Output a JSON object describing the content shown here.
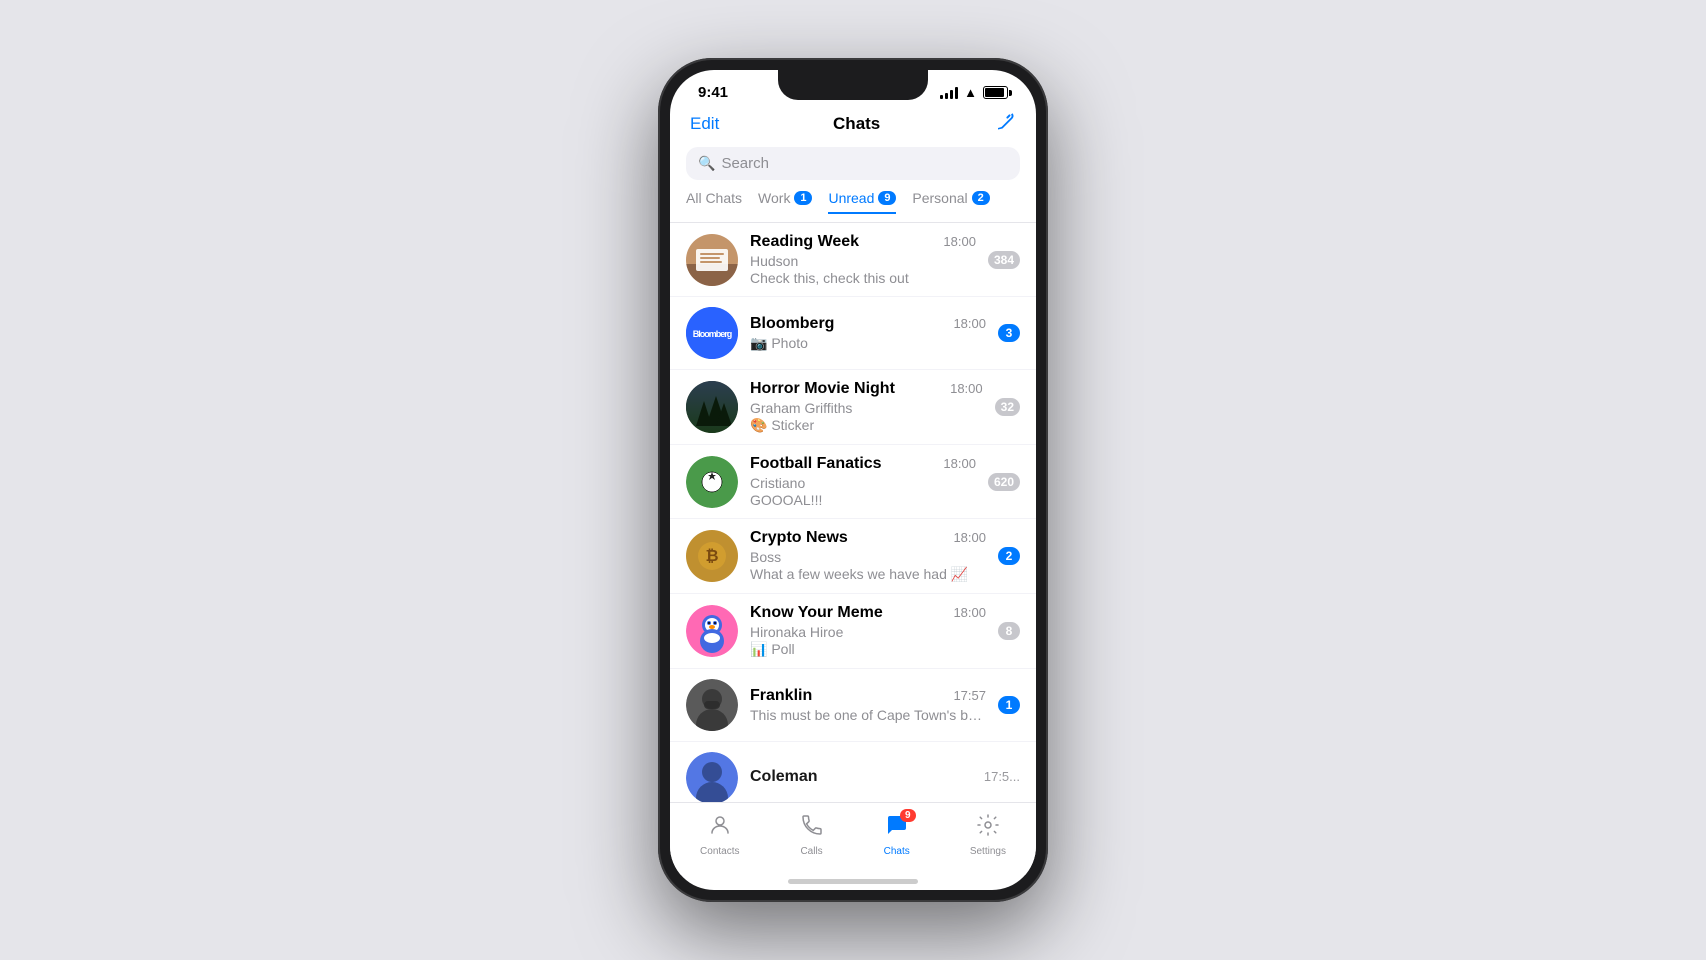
{
  "phone": {
    "status_bar": {
      "time": "9:41"
    },
    "header": {
      "edit_label": "Edit",
      "title": "Chats",
      "compose_icon": "✏"
    },
    "search": {
      "placeholder": "Search"
    },
    "tabs": [
      {
        "id": "all",
        "label": "All Chats",
        "badge": null,
        "active": false
      },
      {
        "id": "work",
        "label": "Work",
        "badge": "1",
        "active": false
      },
      {
        "id": "unread",
        "label": "Unread",
        "badge": "9",
        "active": true
      },
      {
        "id": "personal",
        "label": "Personal",
        "badge": "2",
        "active": false
      }
    ],
    "chats": [
      {
        "id": "reading-week",
        "name": "Reading Week",
        "sender": "Hudson",
        "preview": "Check this, check this out",
        "time": "18:00",
        "unread": "384",
        "unread_type": "gray",
        "avatar_type": "reading"
      },
      {
        "id": "bloomberg",
        "name": "Bloomberg",
        "sender": "",
        "preview": "📷 Photo",
        "time": "18:00",
        "unread": "3",
        "unread_type": "blue",
        "avatar_type": "bloomberg"
      },
      {
        "id": "horror-movie-night",
        "name": "Horror Movie Night",
        "sender": "Graham Griffiths",
        "preview": "🎨 Sticker",
        "time": "18:00",
        "unread": "32",
        "unread_type": "gray",
        "avatar_type": "horror"
      },
      {
        "id": "football-fanatics",
        "name": "Football Fanatics",
        "sender": "Cristiano",
        "preview": "GOOOAL!!!",
        "time": "18:00",
        "unread": "620",
        "unread_type": "gray",
        "avatar_type": "football"
      },
      {
        "id": "crypto-news",
        "name": "Crypto News",
        "sender": "Boss",
        "preview": "What a few weeks we have had 📈",
        "time": "18:00",
        "unread": "2",
        "unread_type": "blue",
        "avatar_type": "crypto"
      },
      {
        "id": "know-your-meme",
        "name": "Know Your Meme",
        "sender": "Hironaka Hiroe",
        "preview": "📊 Poll",
        "time": "18:00",
        "unread": "8",
        "unread_type": "gray",
        "avatar_type": "meme"
      },
      {
        "id": "franklin",
        "name": "Franklin",
        "sender": "",
        "preview": "This must be one of Cape Town's best spots for a stunning view of...",
        "time": "17:57",
        "unread": "1",
        "unread_type": "blue",
        "avatar_type": "franklin"
      },
      {
        "id": "coleman",
        "name": "Coleman",
        "sender": "",
        "preview": "",
        "time": "17:5...",
        "unread": null,
        "unread_type": "",
        "avatar_type": "coleman"
      }
    ],
    "bottom_nav": [
      {
        "id": "contacts",
        "icon": "contacts",
        "label": "Contacts",
        "active": false,
        "badge": null
      },
      {
        "id": "calls",
        "icon": "calls",
        "label": "Calls",
        "active": false,
        "badge": null
      },
      {
        "id": "chats",
        "icon": "chats",
        "label": "Chats",
        "active": true,
        "badge": "9"
      },
      {
        "id": "settings",
        "icon": "settings",
        "label": "Settings",
        "active": false,
        "badge": null
      }
    ]
  }
}
